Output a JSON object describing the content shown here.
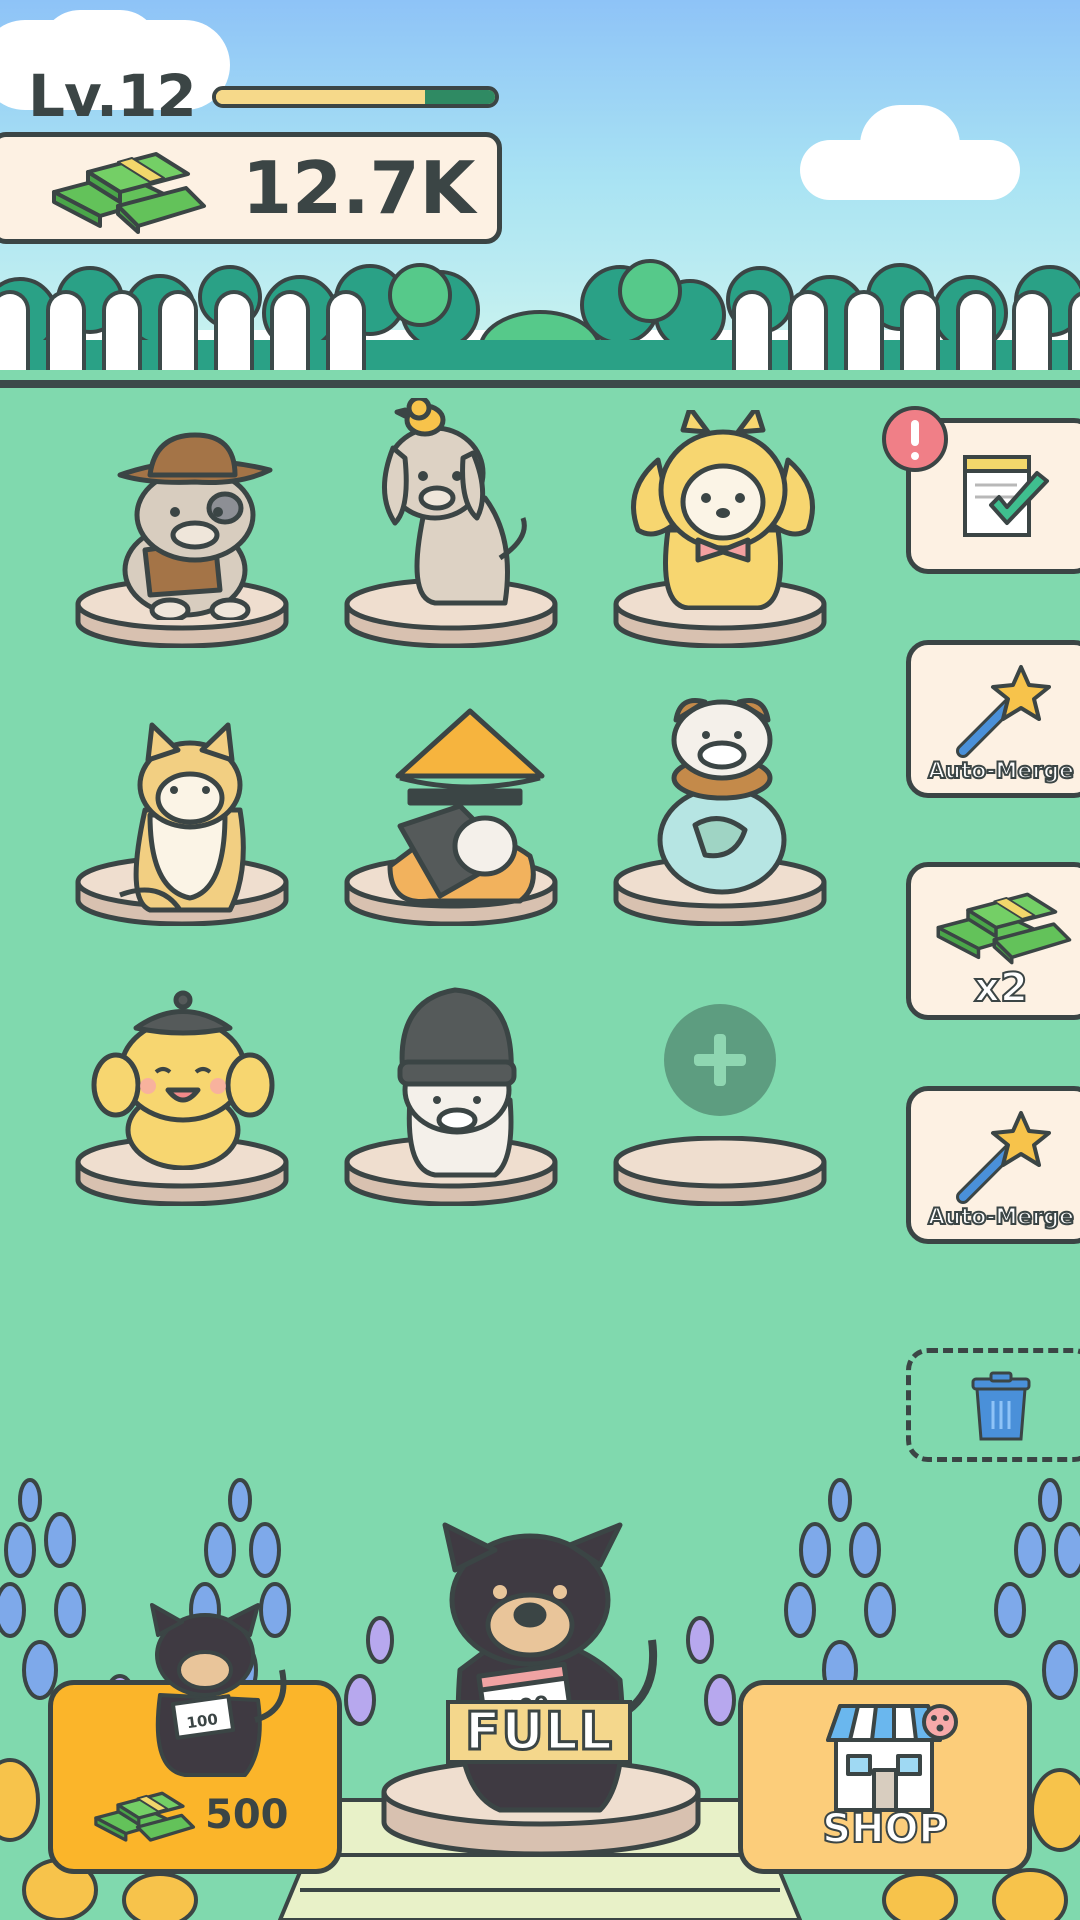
{
  "hud": {
    "level_label": "Lv.12",
    "xp_progress": 0.75,
    "cash_value": "12.7K",
    "cash_icon": "cash-stack-icon"
  },
  "colors": {
    "lawn": "#80d9ae",
    "sky_top": "#8ec3f7",
    "xp_fill": "#f6d98a",
    "xp_track": "#2f8a63",
    "buy_button": "#fbb52a",
    "shop_button": "#fccd7a",
    "alert_badge": "#f07f87"
  },
  "grid": {
    "slots": [
      {
        "pet": "bulldog-cowboy-hat",
        "occupied": true
      },
      {
        "pet": "beige-dog-duck-hat",
        "occupied": true
      },
      {
        "pet": "shiba-bunny-hood",
        "occupied": true
      },
      {
        "pet": "shiba-sitting",
        "occupied": true
      },
      {
        "pet": "corgi-straw-hat",
        "occupied": true
      },
      {
        "pet": "bulldog-fishbowl",
        "occupied": true
      },
      {
        "pet": "poodle-beret",
        "occupied": true
      },
      {
        "pet": "white-dog-beanie",
        "occupied": true
      },
      {
        "pet": "",
        "occupied": false,
        "icon": "plus-icon"
      }
    ]
  },
  "sidebar": {
    "tasks": {
      "icon": "checklist-icon",
      "badge_icon": "exclamation-icon"
    },
    "auto_merge_1": {
      "label": "Auto-Merge",
      "icon": "magic-wand-icon"
    },
    "double_cash": {
      "label": "x2",
      "icon": "cash-stack-icon"
    },
    "auto_merge_2": {
      "label": "Auto-Merge",
      "icon": "magic-wand-icon"
    },
    "trash": {
      "icon": "trash-icon"
    }
  },
  "bottom": {
    "buy": {
      "price": "500",
      "pet": "black-shiba-100"
    },
    "spawner": {
      "label": "FULL",
      "pet": "black-shiba-100"
    },
    "shop": {
      "label": "SHOP",
      "icon": "storefront-icon"
    }
  }
}
